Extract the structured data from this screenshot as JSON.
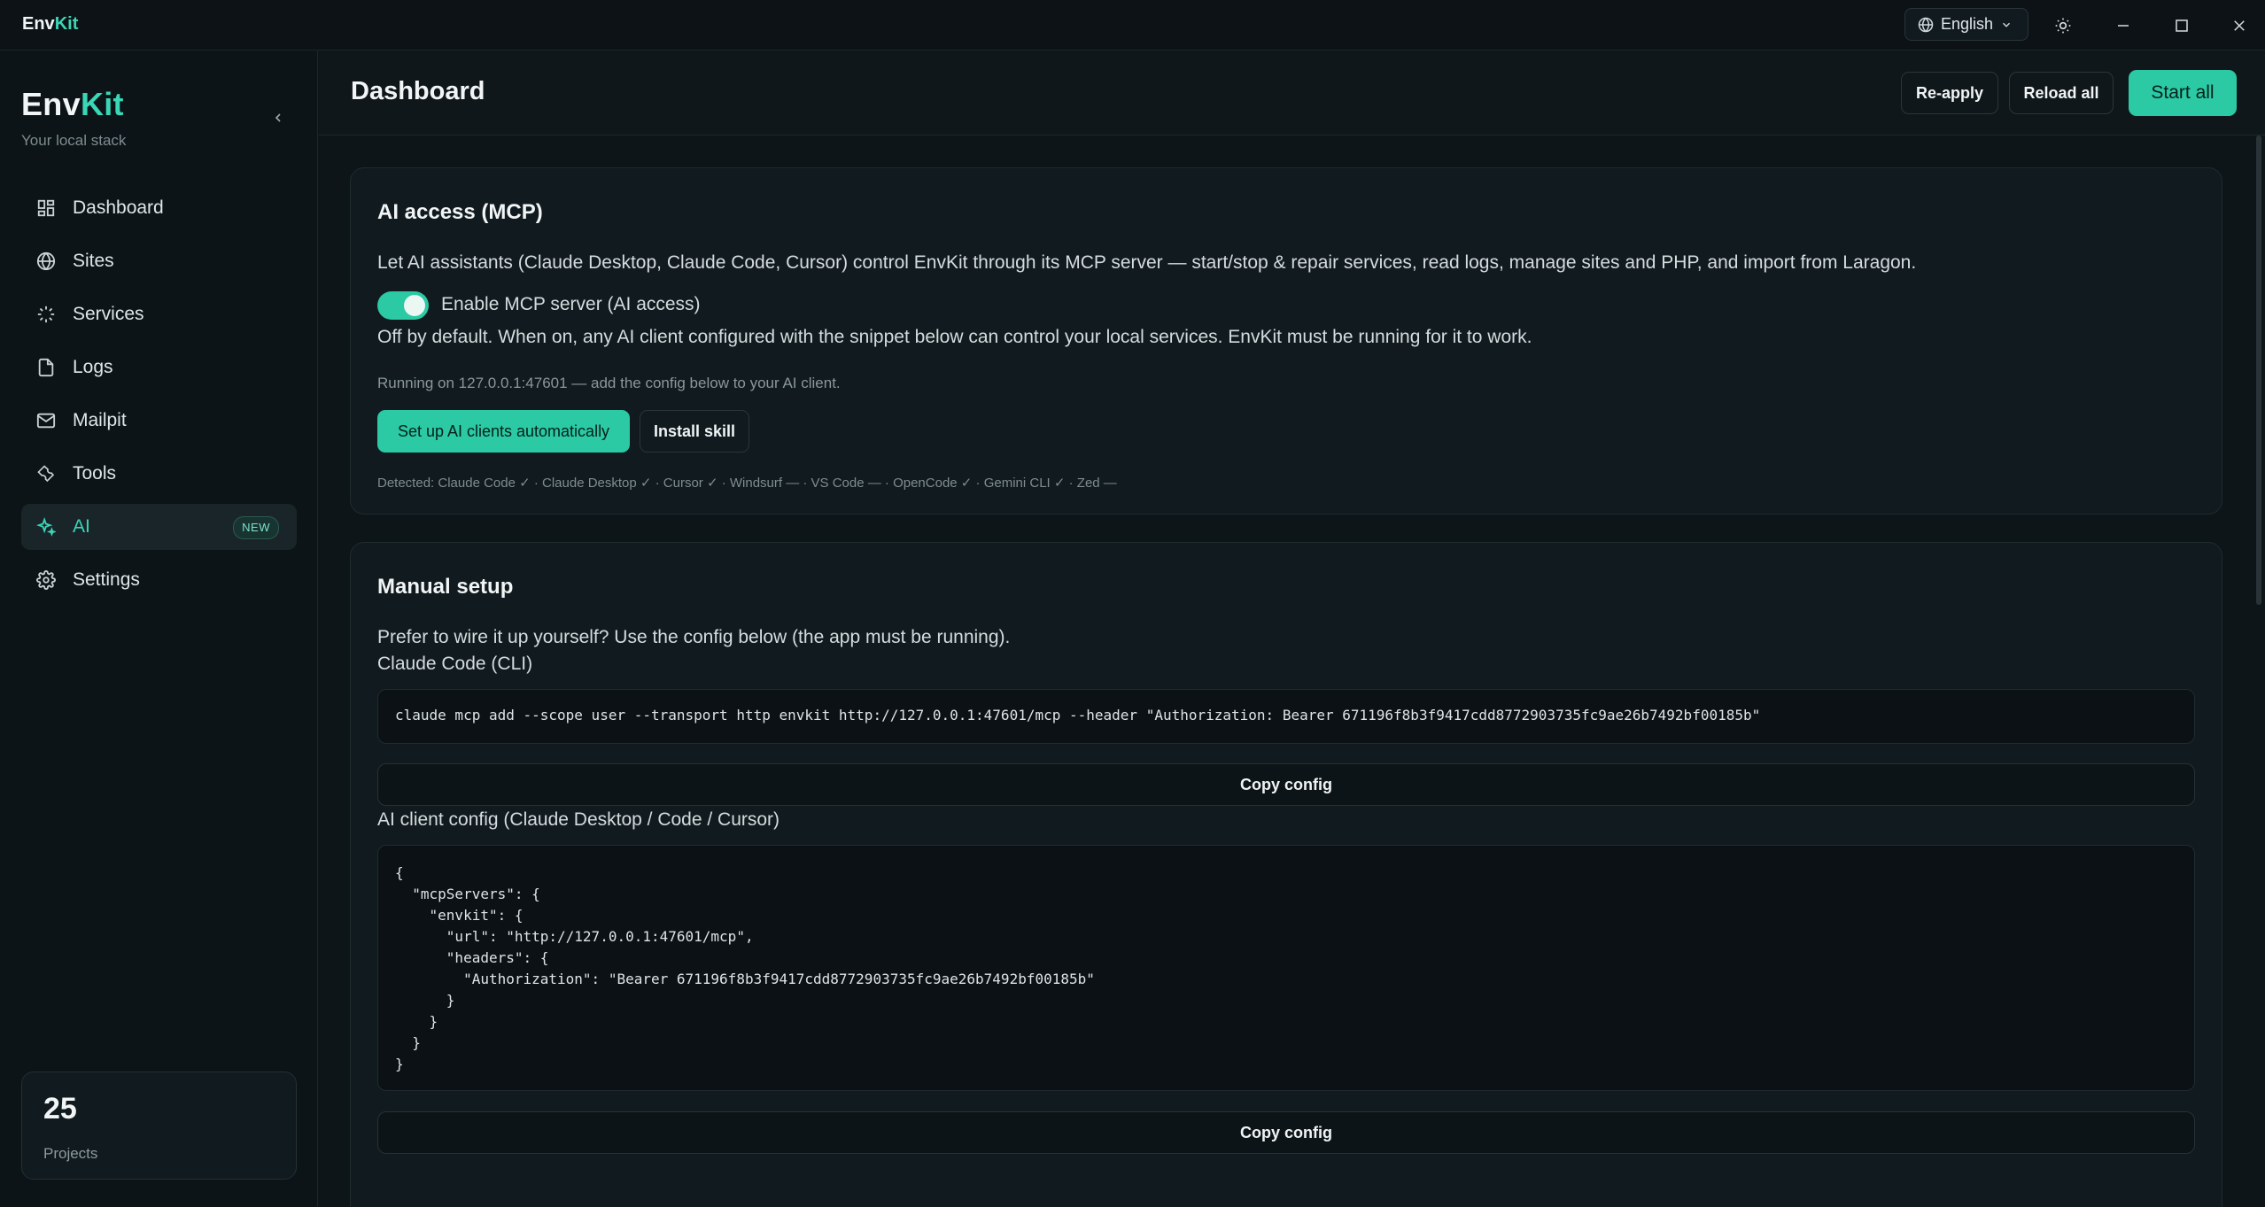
{
  "titlebar": {
    "logo_a": "Env",
    "logo_b": "Kit",
    "language": "English"
  },
  "sidebar": {
    "brand_a": "Env",
    "brand_b": "Kit",
    "tagline": "Your local stack",
    "items": [
      {
        "label": "Dashboard",
        "icon": "dashboard-icon"
      },
      {
        "label": "Sites",
        "icon": "globe-icon"
      },
      {
        "label": "Services",
        "icon": "loader-icon"
      },
      {
        "label": "Logs",
        "icon": "file-icon"
      },
      {
        "label": "Mailpit",
        "icon": "mail-icon"
      },
      {
        "label": "Tools",
        "icon": "wrench-icon"
      },
      {
        "label": "AI",
        "icon": "sparkles-icon",
        "active": true,
        "badge": "NEW"
      },
      {
        "label": "Settings",
        "icon": "gear-icon"
      }
    ],
    "projects": {
      "count": "25",
      "label": "Projects"
    }
  },
  "header": {
    "title": "Dashboard",
    "reapply": "Re-apply",
    "reload": "Reload all",
    "start": "Start all"
  },
  "mcp": {
    "title": "AI access (MCP)",
    "description": "Let AI assistants (Claude Desktop, Claude Code, Cursor) control EnvKit through its MCP server — start/stop & repair services, read logs, manage sites and PHP, and import from Laragon.",
    "toggle_label": "Enable MCP server (AI access)",
    "toggle_on": true,
    "note": "Off by default. When on, any AI client configured with the snippet below can control your local services. EnvKit must be running for it to work.",
    "status": "Running on 127.0.0.1:47601 — add the config below to your AI client.",
    "setup_button": "Set up AI clients automatically",
    "install_button": "Install skill",
    "detected": "Detected: Claude Code ✓ · Claude Desktop ✓ · Cursor ✓ · Windsurf — · VS Code — · OpenCode ✓ · Gemini CLI ✓ · Zed —"
  },
  "manual": {
    "title": "Manual setup",
    "intro": "Prefer to wire it up yourself? Use the config below (the app must be running).",
    "cli_label": "Claude Code (CLI)",
    "cli_command": "claude mcp add --scope user --transport http envkit http://127.0.0.1:47601/mcp --header \"Authorization: Bearer 671196f8b3f9417cdd8772903735fc9ae26b7492bf00185b\"",
    "copy_label": "Copy config",
    "json_label": "AI client config (Claude Desktop / Code / Cursor)",
    "json_config": "{\n  \"mcpServers\": {\n    \"envkit\": {\n      \"url\": \"http://127.0.0.1:47601/mcp\",\n      \"headers\": {\n        \"Authorization\": \"Bearer 671196f8b3f9417cdd8772903735fc9ae26b7492bf00185b\"\n      }\n    }\n  }\n}",
    "copy_label_2": "Copy config"
  },
  "colors": {
    "accent": "#2bc9a4",
    "background": "#0e1519",
    "card": "#111a1e"
  }
}
